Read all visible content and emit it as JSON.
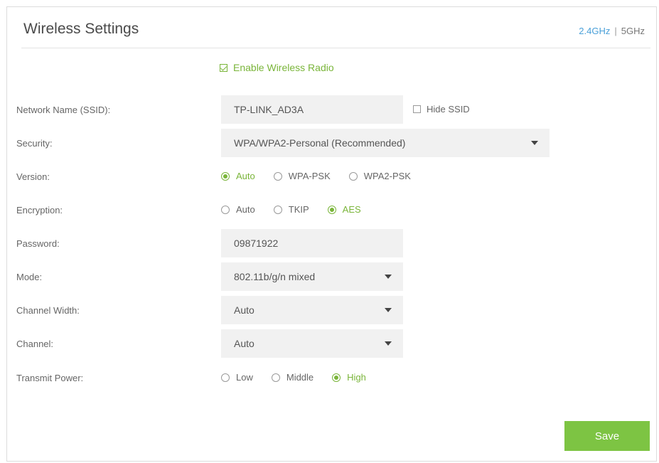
{
  "header": {
    "title": "Wireless Settings",
    "band_active": "2.4GHz",
    "band_separator": "|",
    "band_other": "5GHz"
  },
  "enable_radio": {
    "label": "Enable Wireless Radio",
    "checked": true
  },
  "ssid": {
    "label": "Network Name (SSID):",
    "value": "TP-LINK_AD3A",
    "hide_label": "Hide SSID",
    "hide_checked": false
  },
  "security": {
    "label": "Security:",
    "value": "WPA/WPA2-Personal (Recommended)"
  },
  "version": {
    "label": "Version:",
    "options": [
      "Auto",
      "WPA-PSK",
      "WPA2-PSK"
    ],
    "selected": "Auto"
  },
  "encryption": {
    "label": "Encryption:",
    "options": [
      "Auto",
      "TKIP",
      "AES"
    ],
    "selected": "AES"
  },
  "password": {
    "label": "Password:",
    "value": "09871922"
  },
  "mode": {
    "label": "Mode:",
    "value": "802.11b/g/n mixed"
  },
  "channel_width": {
    "label": "Channel Width:",
    "value": "Auto"
  },
  "channel": {
    "label": "Channel:",
    "value": "Auto"
  },
  "transmit_power": {
    "label": "Transmit Power:",
    "options": [
      "Low",
      "Middle",
      "High"
    ],
    "selected": "High"
  },
  "save_label": "Save",
  "colors": {
    "accent_green": "#7ab53a",
    "active_band_blue": "#4aa0d9",
    "field_bg": "#f1f1f1"
  }
}
